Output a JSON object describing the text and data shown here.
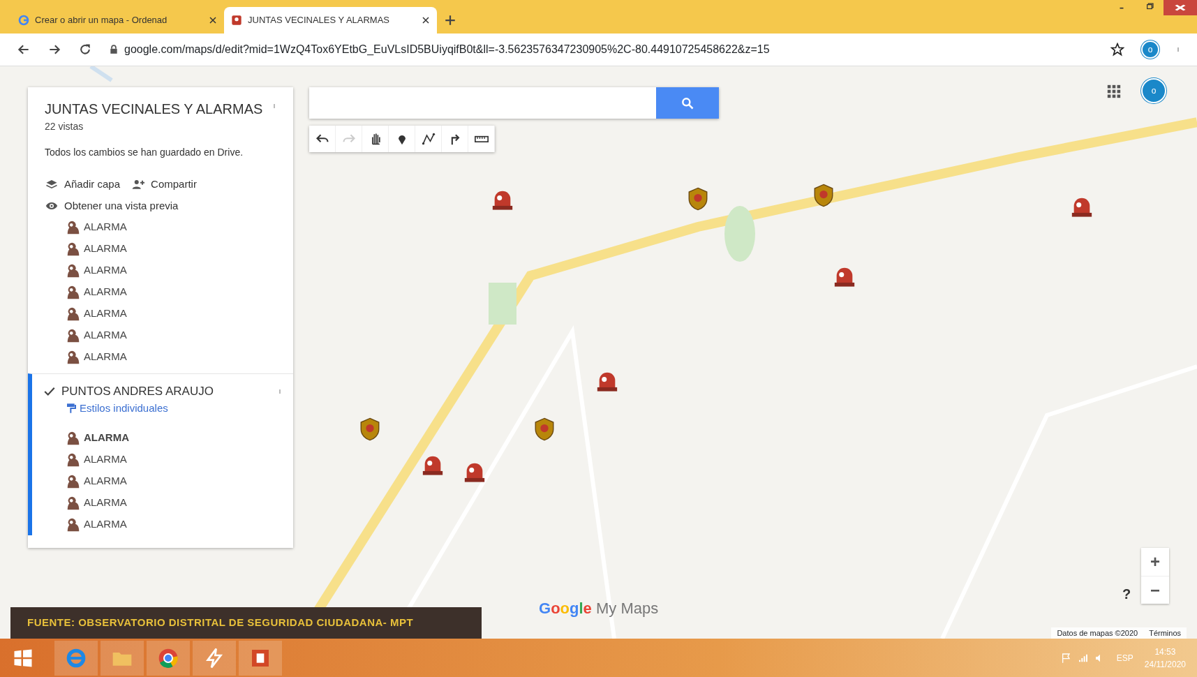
{
  "browser": {
    "tabs": [
      {
        "title": "Crear o abrir un mapa - Ordenad",
        "kind": "google",
        "selected": false
      },
      {
        "title": "JUNTAS VECINALES Y ALARMAS",
        "kind": "maps",
        "selected": true
      }
    ],
    "url": "google.com/maps/d/edit?mid=1WzQ4Tox6YEtbG_EuVLsID5BUiyqifB0t&ll=-3.5623576347230905%2C-80.44910725458622&z=15",
    "avatar": "o"
  },
  "map_panel": {
    "title": "JUNTAS VECINALES Y ALARMAS",
    "views": "22 vistas",
    "status": "Todos los cambios se han guardado en Drive.",
    "actions": [
      {
        "kind": "add_layer",
        "label": "Añadir capa"
      },
      {
        "kind": "share",
        "label": "Compartir"
      },
      {
        "kind": "preview",
        "label": "Obtener una vista previa"
      }
    ],
    "layers": [
      {
        "active": false,
        "items": [
          {
            "label": "ALARMA",
            "selected": false
          },
          {
            "label": "ALARMA",
            "selected": false
          },
          {
            "label": "ALARMA",
            "selected": false
          },
          {
            "label": "ALARMA",
            "selected": false
          },
          {
            "label": "ALARMA",
            "selected": false
          },
          {
            "label": "ALARMA",
            "selected": false
          },
          {
            "label": "ALARMA",
            "selected": false
          }
        ]
      },
      {
        "active": true,
        "title": "PUNTOS ANDRES ARAUJO",
        "checked": true,
        "style_link": "Estilos individuales",
        "items": [
          {
            "label": "ALARMA",
            "selected": true
          },
          {
            "label": "ALARMA",
            "selected": false
          },
          {
            "label": "ALARMA",
            "selected": false
          },
          {
            "label": "ALARMA",
            "selected": false
          },
          {
            "label": "ALARMA",
            "selected": false
          }
        ]
      }
    ]
  },
  "map": {
    "kind": "picture",
    "tools": [
      {
        "kind": "undo",
        "disabled": false
      },
      {
        "kind": "redo",
        "disabled": true
      },
      {
        "kind": "hand",
        "disabled": false
      },
      {
        "kind": "marker",
        "disabled": false
      },
      {
        "kind": "line",
        "disabled": false
      },
      {
        "kind": "route",
        "disabled": false
      },
      {
        "kind": "ruler",
        "disabled": false
      }
    ],
    "logo": "Google My Maps",
    "zoom_in": "+",
    "zoom_out": "−",
    "help": "?",
    "attribution": "Datos de mapas ©2020",
    "terms": "Términos",
    "avatar": "o"
  },
  "caption": "FUENTE: OBSERVATORIO DISTRITAL DE SEGURIDAD CIUDADANA- MPT",
  "taskbar": {
    "apps": [
      {
        "kind": "ie"
      },
      {
        "kind": "folder"
      },
      {
        "kind": "chrome"
      },
      {
        "kind": "app"
      },
      {
        "kind": "powerpoint"
      }
    ],
    "language": "ESP",
    "time": "14:53",
    "date": "24/11/2020"
  }
}
